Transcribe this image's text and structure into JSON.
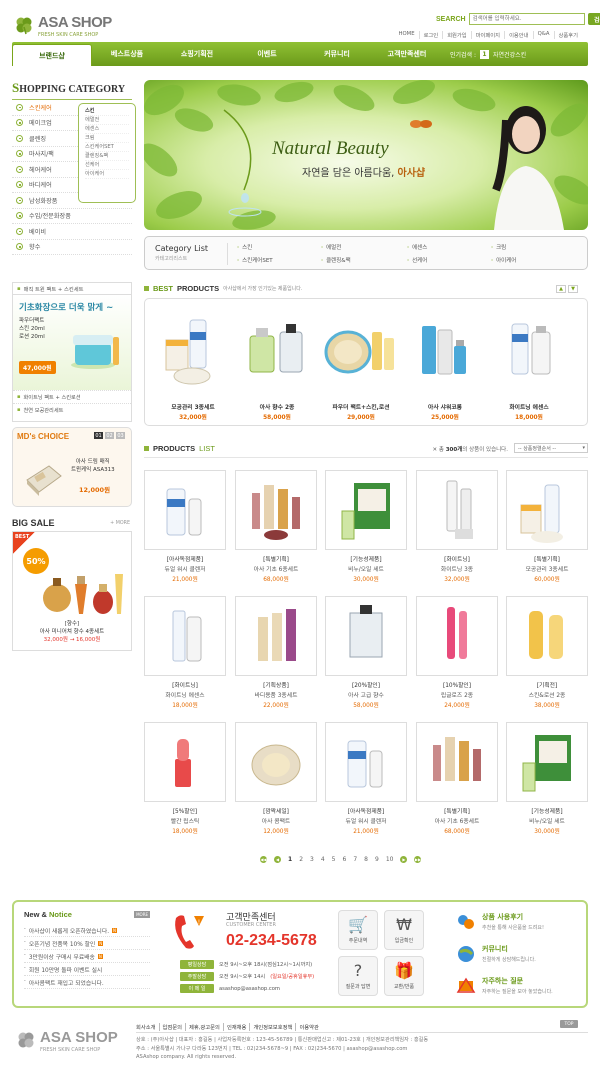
{
  "header": {
    "logo_text": "ASA SHOP",
    "logo_tagline": "FRESH SKIN CARE SHOP",
    "search_label": "SEARCH",
    "search_placeholder": "검색어를 입력하세요.",
    "search_button": "검색",
    "top_links": [
      "HOME",
      "로그인",
      "회원가입",
      "마이페이지",
      "이용안내",
      "Q&A",
      "상품후기"
    ]
  },
  "nav": {
    "items": [
      "브랜드샵",
      "베스트상품",
      "쇼핑기획전",
      "이벤트",
      "커뮤니티",
      "고객만족센터"
    ],
    "popular_label": "인기검색 :",
    "popular_num": "1",
    "popular_term": "자연건강스킨"
  },
  "sidebar": {
    "title_first": "S",
    "title_rest": "HOPPING CATEGORY",
    "categories": [
      "스킨케어",
      "메이크업",
      "클렌징",
      "마사지/팩",
      "헤어케어",
      "바디케어",
      "남성화장품",
      "수입/전문화장품",
      "베이비",
      "향수"
    ],
    "subcategories": [
      "스킨",
      "에멀전",
      "에센스",
      "크림",
      "스킨케어SET",
      "클렌징&팩",
      "선케어",
      "아이케어"
    ],
    "promo_header": "매직 트윈 팩트 + 스킨세트",
    "promo_headline": "기초화장으로 더욱 맑게 ~",
    "promo_line1": "파우더팩트",
    "promo_line2": "스킨 20ml",
    "promo_line3": "로션 20ml",
    "promo_price": "47,000원",
    "promo_links": [
      "화이트닝 팩트 + 스킨로션",
      "천연 모공관리세트"
    ],
    "mds_title": "MD's CHOICE",
    "mds_pages": [
      "01",
      "02",
      "03"
    ],
    "mds_name1": "아사 드림 매직",
    "mds_name2": "트윈케익 ASA313",
    "mds_price": "12,000원",
    "bigsale_title": "BIG SALE",
    "bigsale_more": "+ MORE",
    "bigsale_badge": "BEST",
    "bigsale_pct": "50%",
    "bigsale_cat": "[향수]",
    "bigsale_name": "아사 미니어쳐 향수 4종세트",
    "bigsale_old": "32,000원",
    "bigsale_arrow": "→",
    "bigsale_new": "16,000원"
  },
  "banner": {
    "title": "Natural Beauty",
    "subtitle_a": "자연을 담은 아름다움, ",
    "subtitle_b": "아사샵"
  },
  "category_list": {
    "title": "Category List",
    "subtitle": "카테고리리스트",
    "items": [
      "스킨",
      "에멀전",
      "에센스",
      "크림",
      "스킨케어SET",
      "클렌징&팩",
      "선케어",
      "아이케어"
    ]
  },
  "best": {
    "title_a": "BEST",
    "title_b": "PRODUCTS",
    "desc": "아사샵에서 가장 인기있는 제품입니다.",
    "items": [
      {
        "name": "모공관리 3종세트",
        "price": "32,000원"
      },
      {
        "name": "아사 향수 2종",
        "price": "58,000원"
      },
      {
        "name": "파우더 팩트+스킨,로션",
        "price": "29,000원"
      },
      {
        "name": "아사 샤워코롱",
        "price": "25,000원"
      },
      {
        "name": "화이트닝 에센스",
        "price": "18,000원"
      }
    ]
  },
  "products": {
    "title_a": "PRODUCTS",
    "title_b": "LIST",
    "count_prefix": "총",
    "count": "300개",
    "count_suffix": "의 상품이 있습니다.",
    "sort_label": "-- 상품정렬순서 --",
    "items": [
      {
        "cat": "[아사독점제품]",
        "name": "듀얼 워시 클렌저",
        "price": "21,000원"
      },
      {
        "cat": "[특별기획]",
        "name": "아사 기초 6종세트",
        "price": "68,000원"
      },
      {
        "cat": "[기능성제품]",
        "name": "비누/오일 세트",
        "price": "30,000원"
      },
      {
        "cat": "[화이트닝]",
        "name": "화이트닝 3종",
        "price": "32,000원"
      },
      {
        "cat": "[특별기획]",
        "name": "모공관리 3종세트",
        "price": "60,000원"
      },
      {
        "cat": "[화이트닝]",
        "name": "화이트닝 에센스",
        "price": "18,000원"
      },
      {
        "cat": "[기획상품]",
        "name": "바디용품 3종세트",
        "price": "22,000원"
      },
      {
        "cat": "[20%할인]",
        "name": "아사 고급 향수",
        "price": "58,000원"
      },
      {
        "cat": "[10%할인]",
        "name": "립글로즈 2종",
        "price": "24,000원"
      },
      {
        "cat": "[기획전]",
        "name": "스킨&로션 2종",
        "price": "38,000원"
      },
      {
        "cat": "[5%할인]",
        "name": "빨간 립스틱",
        "price": "18,000원"
      },
      {
        "cat": "[깜짝세일]",
        "name": "아사 콤팩트",
        "price": "12,000원"
      },
      {
        "cat": "[아사독점제품]",
        "name": "듀얼 워시 클렌저",
        "price": "21,000원"
      },
      {
        "cat": "[특별기획]",
        "name": "아사 기초 6종세트",
        "price": "68,000원"
      },
      {
        "cat": "[기능성제품]",
        "name": "비누/오일 세트",
        "price": "30,000원"
      }
    ],
    "pages": [
      "1",
      "2",
      "3",
      "4",
      "5",
      "6",
      "7",
      "8",
      "9",
      "10"
    ]
  },
  "news": {
    "title_a": "New & ",
    "title_b": "Notice",
    "more": "MORE",
    "items": [
      "아사샵이 새롭게 오픈하였습니다.",
      "오픈기념 전품목 10% 할인",
      "3만원이상 구매시 무료배송",
      "회원 10만명 돌파 이벤트 실시",
      "아사콤팩트 재입고 되었습니다."
    ]
  },
  "customer_center": {
    "title": "고객만족센터",
    "subtitle": "CUSTOMER CENTER",
    "phone": "02-234-5678",
    "rows": [
      {
        "label": "평일상담",
        "text": "오전 9시~오후 18시(점심12시~1시까지)"
      },
      {
        "label": "주말상담",
        "text": "오전 9시~오후 14시",
        "red": "(일요일/공휴일휴무)"
      },
      {
        "label": "이 메 일",
        "text": "asashop@asashop.com"
      }
    ]
  },
  "quick_icons": [
    "주문내역",
    "입금확인",
    "질문과 답변",
    "교환/반품"
  ],
  "right_links": [
    {
      "title": "상품 사용후기",
      "desc": "추천을 통해 사은품을 드려요!"
    },
    {
      "title": "커뮤니티",
      "desc": "친절하게 상담해드립니다."
    },
    {
      "title": "자주하는 질문",
      "desc": "자주하는 질문을 모아 놓았습니다."
    }
  ],
  "footer": {
    "logo_text": "ASA SHOP",
    "logo_tagline": "FRESH SKIN CARE SHOP",
    "links": [
      "회사소개",
      "입점문의",
      "제휴,광고문의",
      "인재채용",
      "개인정보보호정책",
      "이용약관"
    ],
    "top": "TOP",
    "line1": "상호 : (주)아사샵  |  대표자 : 홍길동  |  사업자등록번호 : 123-45-56789  |  통신판매업신고 : 제01-23호  |  개인정보관리책임자 : 홍길동",
    "line2": "주소 : 서울특별시 가나구 다라동 123번지  |  TEL : 02)234-5678~9  |  FAX : 02)234-5670  |  asashop@asashop.com",
    "line3": "ASAshop company. All rights reserved."
  },
  "colors": {
    "accent": "#7aa51a",
    "price": "#e46a00",
    "phone": "#e4352b"
  }
}
